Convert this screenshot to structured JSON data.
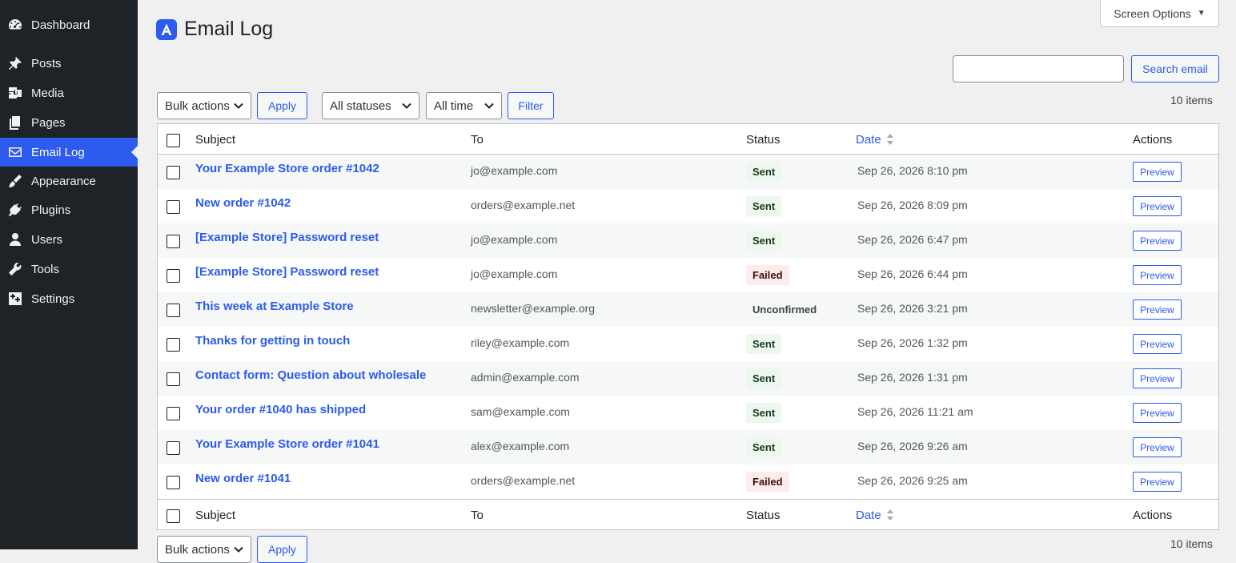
{
  "sidebar": {
    "items": [
      {
        "label": "Dashboard",
        "icon": "dashboard-icon"
      },
      {
        "label": "Posts",
        "icon": "pin-icon"
      },
      {
        "label": "Media",
        "icon": "media-icon"
      },
      {
        "label": "Pages",
        "icon": "pages-icon"
      },
      {
        "label": "Email Log",
        "icon": "envelope-icon",
        "active": true
      },
      {
        "label": "Appearance",
        "icon": "brush-icon"
      },
      {
        "label": "Plugins",
        "icon": "plugin-icon"
      },
      {
        "label": "Users",
        "icon": "user-icon"
      },
      {
        "label": "Tools",
        "icon": "wrench-icon"
      },
      {
        "label": "Settings",
        "icon": "settings-icon"
      }
    ]
  },
  "header": {
    "title": "Email Log",
    "screen_options": "Screen Options"
  },
  "search": {
    "value": "",
    "button": "Search email"
  },
  "tablenav_top": {
    "bulk_actions": "Bulk actions",
    "apply": "Apply",
    "status_filter": "All statuses",
    "time_filter": "All time",
    "filter": "Filter",
    "items_count": "10 items"
  },
  "tablenav_bottom": {
    "bulk_actions": "Bulk actions",
    "apply": "Apply",
    "items_count": "10 items"
  },
  "table": {
    "columns": {
      "subject": "Subject",
      "to": "To",
      "status": "Status",
      "date": "Date",
      "actions": "Actions"
    },
    "rows": [
      {
        "subject": "Your Example Store order #1042",
        "to": "jo@example.com",
        "status": "Sent",
        "status_type": "sent",
        "date": "Sep 26, 2026 8:10 pm",
        "action": "Preview"
      },
      {
        "subject": "New order #1042",
        "to": "orders@example.net",
        "status": "Sent",
        "status_type": "sent",
        "date": "Sep 26, 2026 8:09 pm",
        "action": "Preview"
      },
      {
        "subject": "[Example Store] Password reset",
        "to": "jo@example.com",
        "status": "Sent",
        "status_type": "sent",
        "date": "Sep 26, 2026 6:47 pm",
        "action": "Preview"
      },
      {
        "subject": "[Example Store] Password reset",
        "to": "jo@example.com",
        "status": "Failed",
        "status_type": "failed",
        "date": "Sep 26, 2026 6:44 pm",
        "action": "Preview"
      },
      {
        "subject": "This week at Example Store",
        "to": "newsletter@example.org",
        "status": "Unconfirmed",
        "status_type": "unconfirmed",
        "date": "Sep 26, 2026 3:21 pm",
        "action": "Preview"
      },
      {
        "subject": "Thanks for getting in touch",
        "to": "riley@example.com",
        "status": "Sent",
        "status_type": "sent",
        "date": "Sep 26, 2026 1:32 pm",
        "action": "Preview"
      },
      {
        "subject": "Contact form: Question about wholesale",
        "to": "admin@example.com",
        "status": "Sent",
        "status_type": "sent",
        "date": "Sep 26, 2026 1:31 pm",
        "action": "Preview"
      },
      {
        "subject": "Your order #1040 has shipped",
        "to": "sam@example.com",
        "status": "Sent",
        "status_type": "sent",
        "date": "Sep 26, 2026 11:21 am",
        "action": "Preview"
      },
      {
        "subject": "Your Example Store order #1041",
        "to": "alex@example.com",
        "status": "Sent",
        "status_type": "sent",
        "date": "Sep 26, 2026 9:26 am",
        "action": "Preview"
      },
      {
        "subject": "New order #1041",
        "to": "orders@example.net",
        "status": "Failed",
        "status_type": "failed",
        "date": "Sep 26, 2026 9:25 am",
        "action": "Preview"
      }
    ]
  },
  "colors": {
    "accent": "#2c5bed",
    "sidebar_bg": "#1d2327",
    "sent_bg": "#edf7ee",
    "failed_bg": "#fcecec"
  }
}
